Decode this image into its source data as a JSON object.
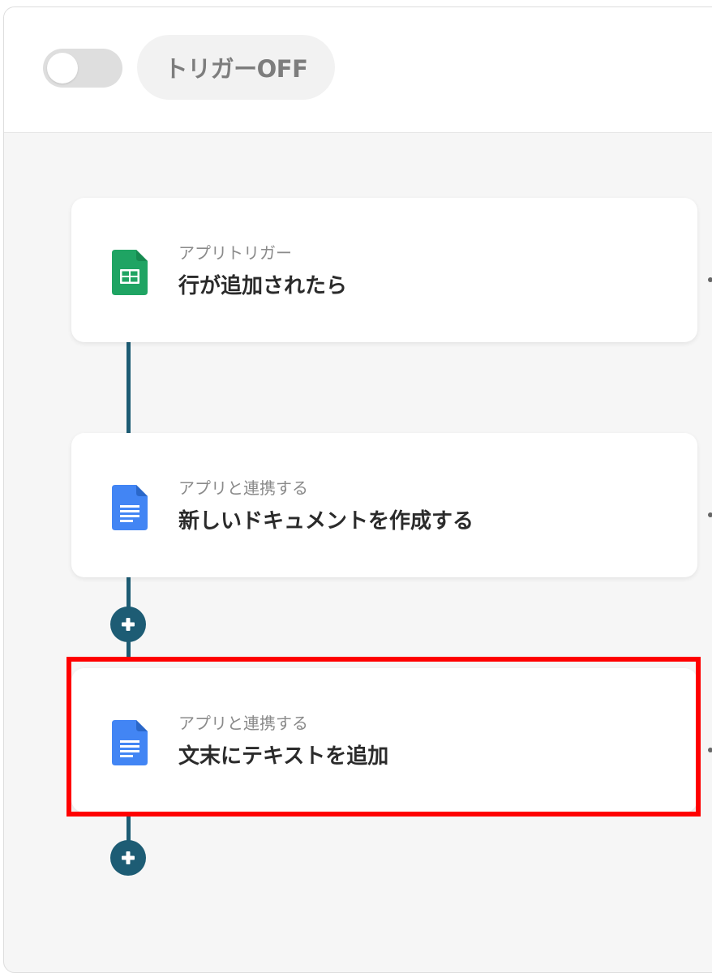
{
  "header": {
    "trigger_status_label": "トリガーOFF",
    "trigger_enabled": false
  },
  "flow": {
    "steps": [
      {
        "subtitle": "アプリトリガー",
        "title": "行が追加されたら",
        "app_icon": "google-sheets-icon"
      },
      {
        "subtitle": "アプリと連携する",
        "title": "新しいドキュメントを作成する",
        "app_icon": "google-docs-icon"
      },
      {
        "subtitle": "アプリと連携する",
        "title": "文末にテキストを追加",
        "app_icon": "google-docs-icon",
        "highlighted": true
      }
    ]
  },
  "colors": {
    "connector": "#1d5c74",
    "highlight": "#ff0000",
    "sheets_green": "#1fa463",
    "docs_blue": "#4285f4"
  }
}
